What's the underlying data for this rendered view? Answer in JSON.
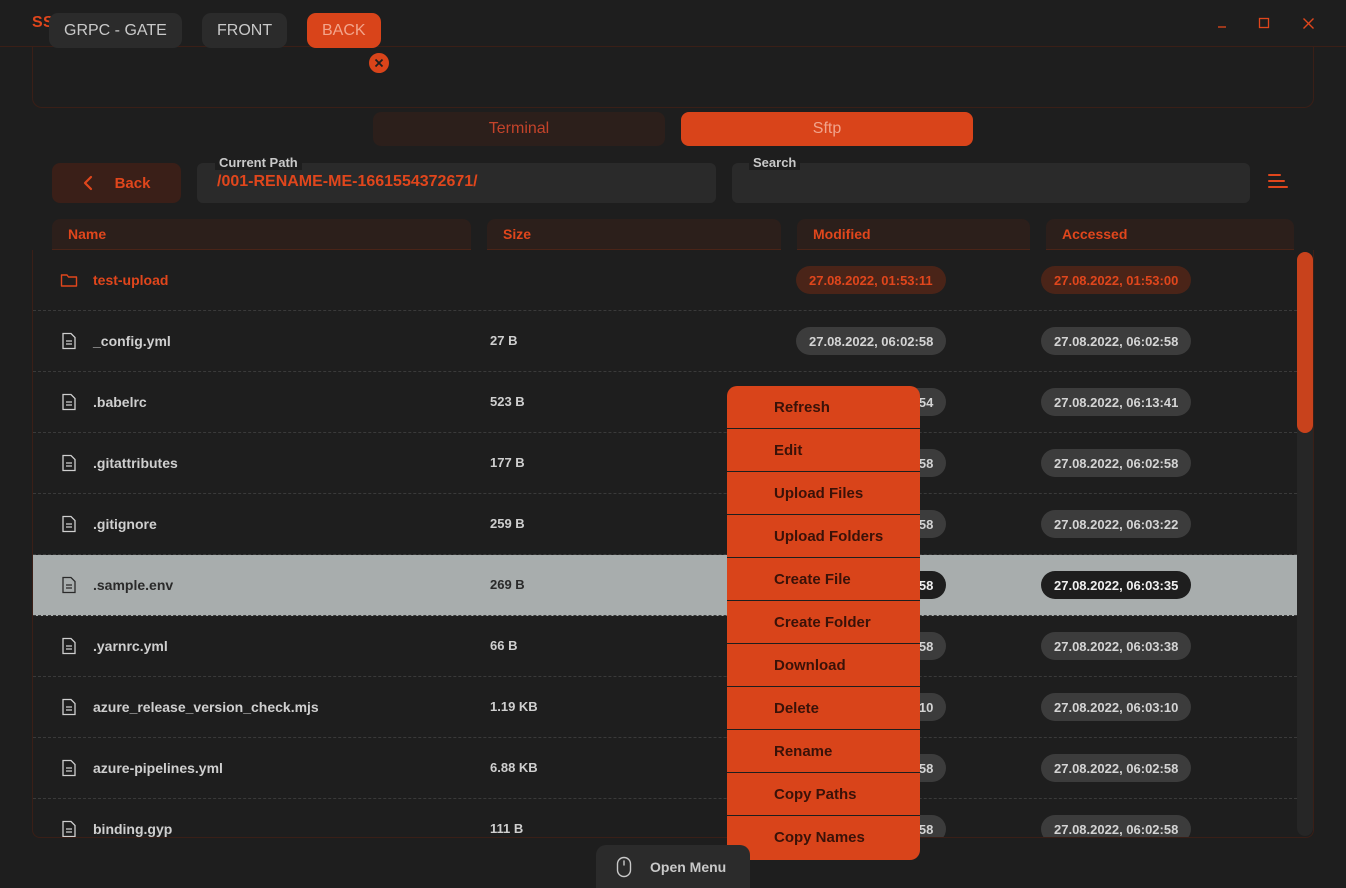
{
  "app": {
    "title": "SSHONIX",
    "accent_color": "#e0461c",
    "window_controls": [
      "minimize-icon",
      "maximize-icon",
      "close-icon"
    ]
  },
  "hosts": {
    "tabs": [
      {
        "label": "GRPC - GATE",
        "active": false
      },
      {
        "label": "FRONT",
        "active": false
      },
      {
        "label": "BACK",
        "active": true
      }
    ]
  },
  "modes": {
    "tabs": [
      {
        "label": "Terminal",
        "active": false
      },
      {
        "label": "Sftp",
        "active": true
      }
    ]
  },
  "toolbar": {
    "back_label": "Back",
    "path_label": "Current Path",
    "path_value": "/001-RENAME-ME-1661554372671/",
    "search_label": "Search",
    "search_value": ""
  },
  "table": {
    "columns": [
      "Name",
      "Size",
      "Modified",
      "Accessed"
    ],
    "rows": [
      {
        "type": "folder",
        "name": "test-upload",
        "size": "",
        "modified": "27.08.2022, 01:53:11",
        "accessed": "27.08.2022, 01:53:00",
        "selected": false
      },
      {
        "type": "file",
        "name": "_config.yml",
        "size": "27 B",
        "modified": "27.08.2022, 06:02:58",
        "accessed": "27.08.2022, 06:02:58",
        "selected": false
      },
      {
        "type": "file",
        "name": ".babelrc",
        "size": "523 B",
        "modified": "27.08.2022, 06:13:54",
        "accessed": "27.08.2022, 06:13:41",
        "selected": false
      },
      {
        "type": "file",
        "name": ".gitattributes",
        "size": "177 B",
        "modified": "27.08.2022, 06:02:58",
        "accessed": "27.08.2022, 06:02:58",
        "selected": false
      },
      {
        "type": "file",
        "name": ".gitignore",
        "size": "259 B",
        "modified": "27.08.2022, 06:02:58",
        "accessed": "27.08.2022, 06:03:22",
        "selected": false
      },
      {
        "type": "file",
        "name": ".sample.env",
        "size": "269 B",
        "modified": "27.08.2022, 06:02:58",
        "accessed": "27.08.2022, 06:03:35",
        "selected": true
      },
      {
        "type": "file",
        "name": ".yarnrc.yml",
        "size": "66 B",
        "modified": "27.08.2022, 06:02:58",
        "accessed": "27.08.2022, 06:03:38",
        "selected": false
      },
      {
        "type": "file",
        "name": "azure_release_version_check.mjs",
        "size": "1.19 KB",
        "modified": "27.08.2022, 06:03:10",
        "accessed": "27.08.2022, 06:03:10",
        "selected": false
      },
      {
        "type": "file",
        "name": "azure-pipelines.yml",
        "size": "6.88 KB",
        "modified": "27.08.2022, 06:02:58",
        "accessed": "27.08.2022, 06:02:58",
        "selected": false
      },
      {
        "type": "file",
        "name": "binding.gyp",
        "size": "111 B",
        "modified": "27.08.2022, 06:02:58",
        "accessed": "27.08.2022, 06:02:58",
        "selected": false
      }
    ]
  },
  "context_menu": {
    "items": [
      "Refresh",
      "Edit",
      "Upload Files",
      "Upload Folders",
      "Create File",
      "Create Folder",
      "Download",
      "Delete",
      "Rename",
      "Copy Paths",
      "Copy Names"
    ]
  },
  "bottom": {
    "open_menu_label": "Open Menu"
  }
}
